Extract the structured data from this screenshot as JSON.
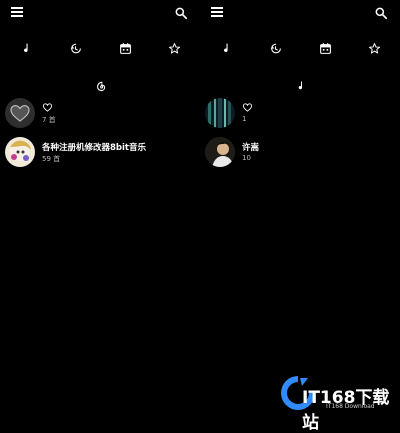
{
  "left_pane": {
    "rows": [
      {
        "title": "",
        "subtitle": "7 首"
      },
      {
        "title": "各种注册机修改器8bit音乐",
        "subtitle": "59 首"
      }
    ]
  },
  "right_pane": {
    "rows": [
      {
        "title": "",
        "subtitle": "1"
      },
      {
        "title": "许嵩",
        "subtitle": "10"
      }
    ]
  },
  "icons": {
    "menu": "menu-icon",
    "search": "search-icon",
    "tabs": [
      "music-note-icon",
      "history-icon",
      "calendar-icon",
      "star-icon"
    ],
    "left_section": "netease-cloud-icon",
    "right_section": "music-note-icon",
    "like": "heart-icon"
  },
  "watermark": {
    "brand": "IT168下载站",
    "sub": "IT168 Download"
  },
  "colors": {
    "background": "#000000",
    "text": "#ffffff",
    "subtext": "#bbbbbb",
    "watermark_blue": "#2f8bff"
  }
}
